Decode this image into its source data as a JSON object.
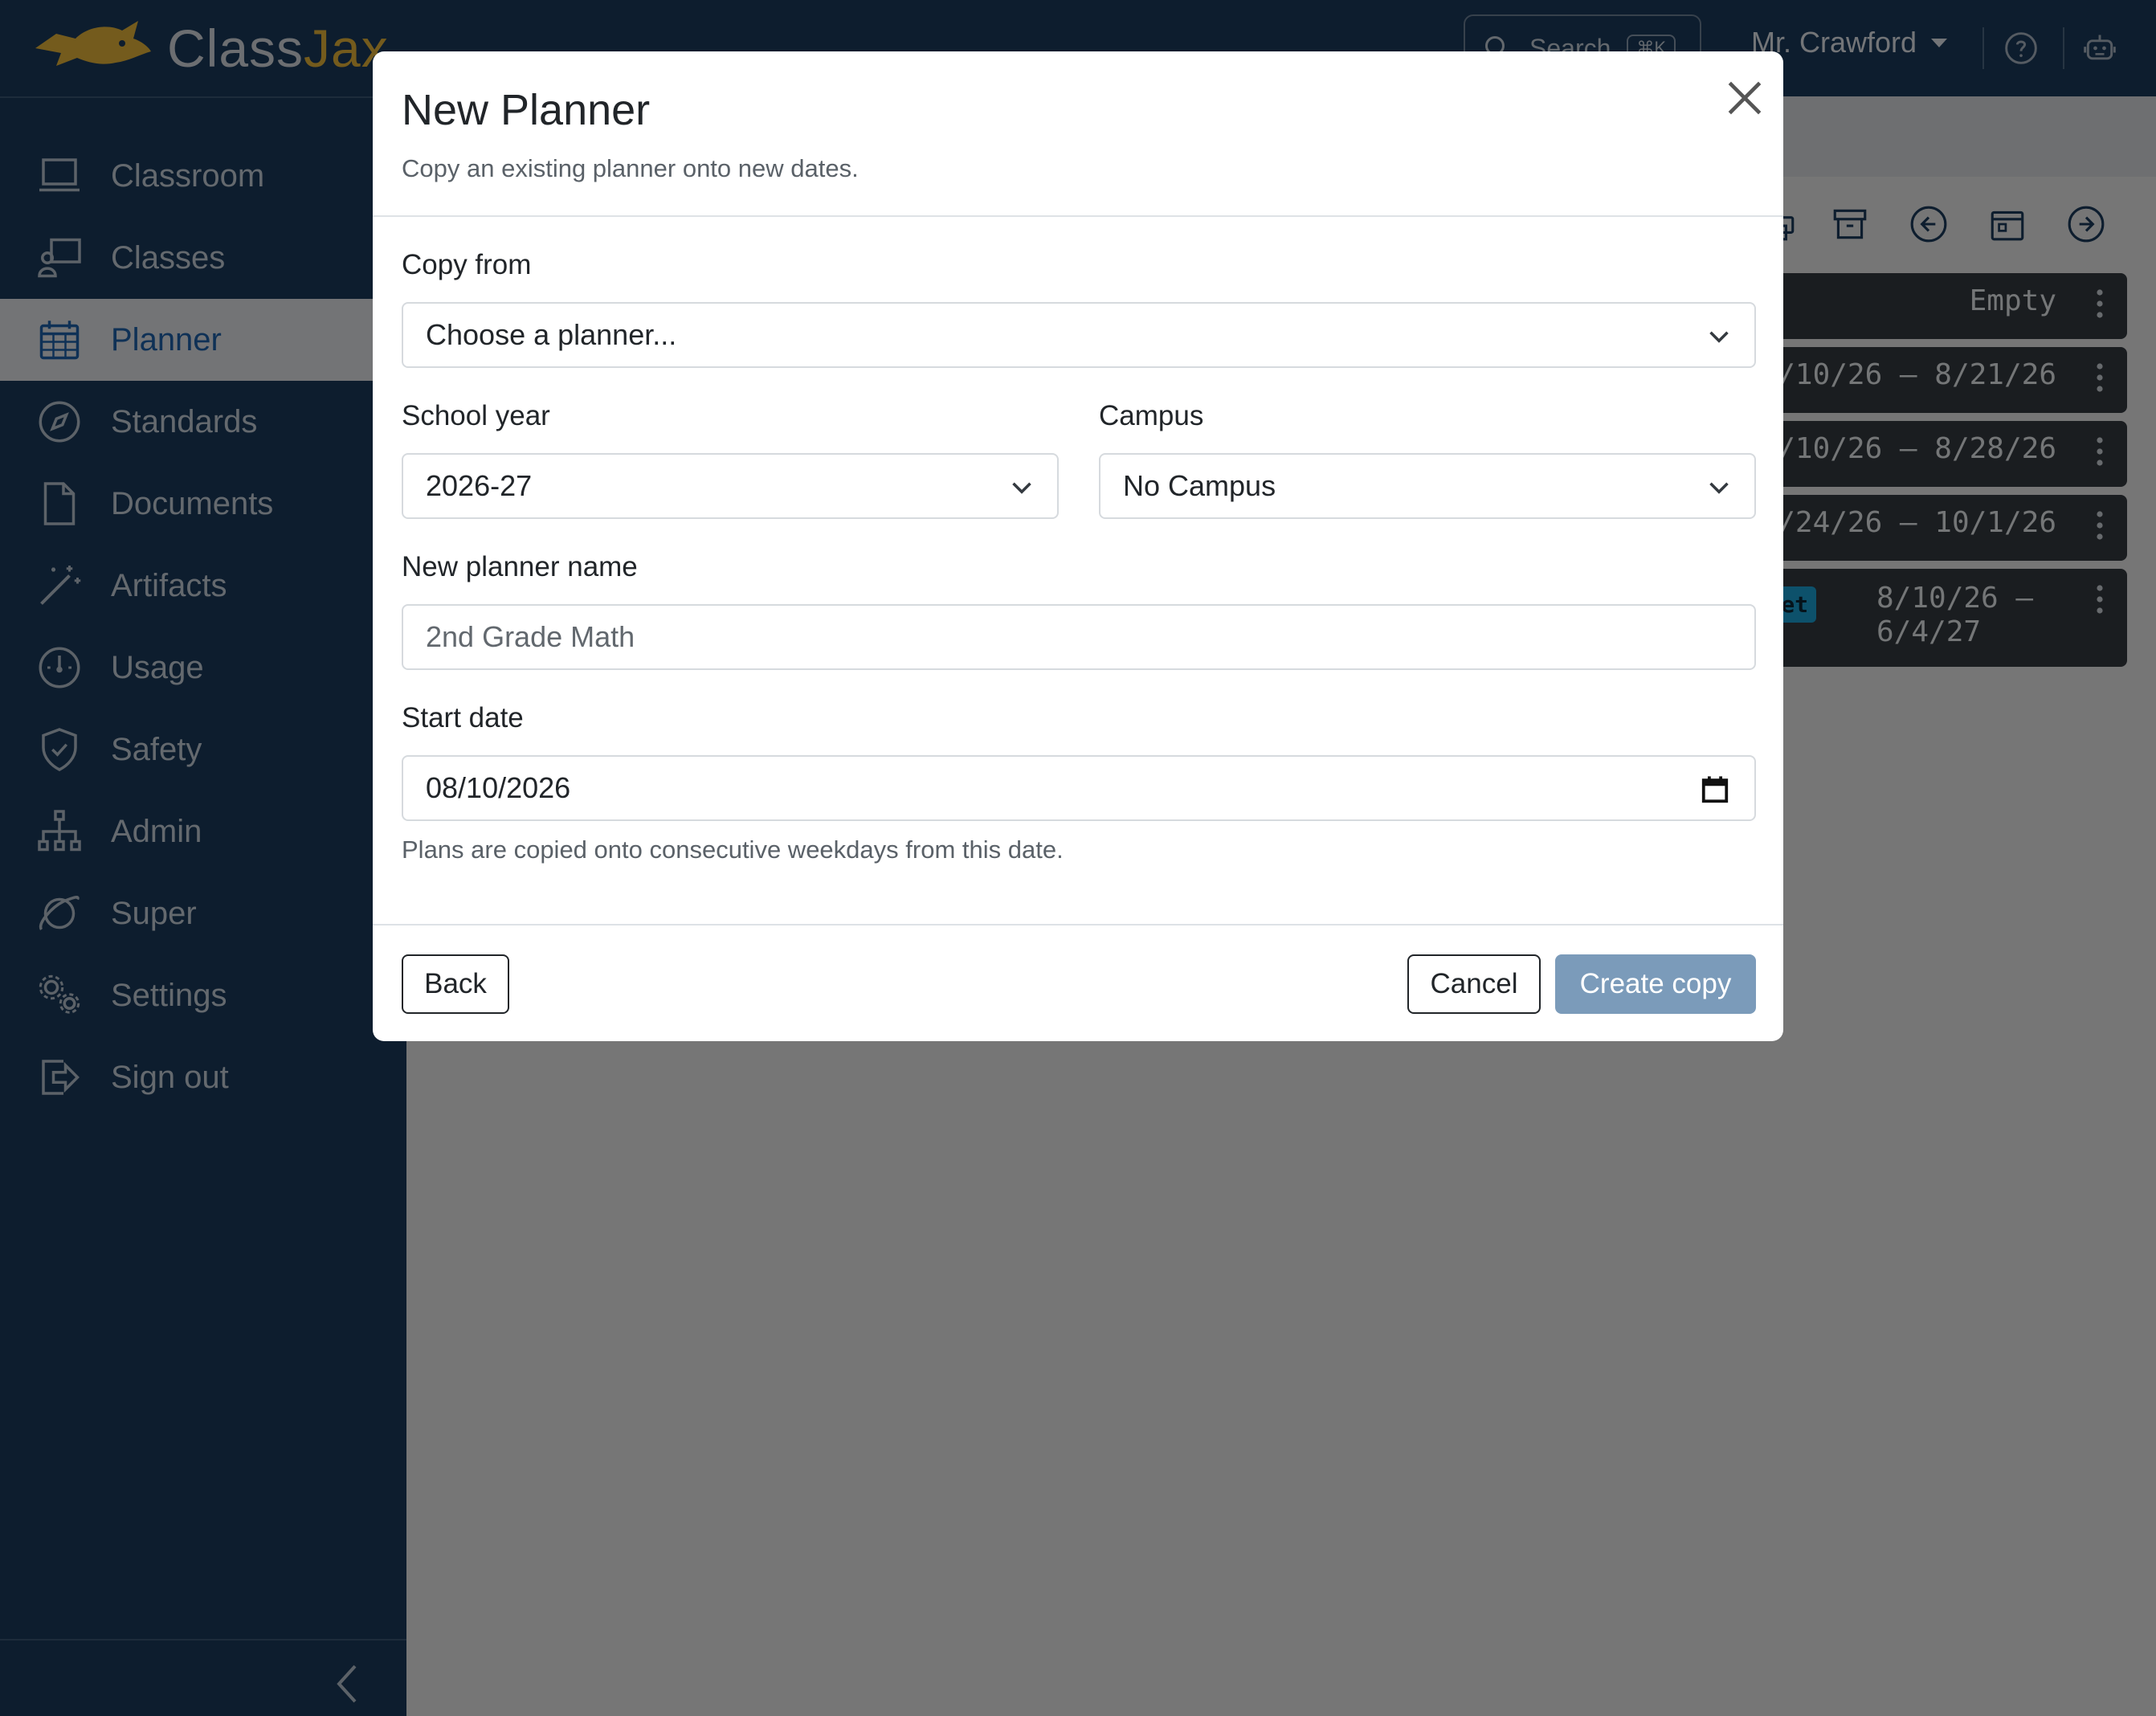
{
  "app": {
    "brand_class": "Class",
    "brand_jax": "Jax",
    "search_placeholder": "Search",
    "search_shortcut": "⌘K",
    "user_name": "Mr. Crawford"
  },
  "sidebar": {
    "items": [
      {
        "label": "Classroom",
        "icon": "laptop-icon"
      },
      {
        "label": "Classes",
        "icon": "teacher-board-icon"
      },
      {
        "label": "Planner",
        "icon": "calendar-grid-icon",
        "active": true
      },
      {
        "label": "Standards",
        "icon": "compass-icon"
      },
      {
        "label": "Documents",
        "icon": "document-icon"
      },
      {
        "label": "Artifacts",
        "icon": "magic-wand-icon"
      },
      {
        "label": "Usage",
        "icon": "gauge-icon"
      },
      {
        "label": "Safety",
        "icon": "shield-check-icon"
      },
      {
        "label": "Admin",
        "icon": "org-chart-icon"
      },
      {
        "label": "Super",
        "icon": "orbit-icon"
      },
      {
        "label": "Settings",
        "icon": "gears-icon"
      },
      {
        "label": "Sign out",
        "icon": "sign-out-icon"
      }
    ]
  },
  "background": {
    "planner_rows": [
      {
        "text": "Empty"
      },
      {
        "text": "/10/26 – 8/21/26"
      },
      {
        "text": "/10/26 – 8/28/26"
      },
      {
        "text": "/24/26 – 10/1/26"
      },
      {
        "badge": "Sacket",
        "text_line1": "8/10/26 –",
        "text_line2": "6/4/27"
      }
    ]
  },
  "modal": {
    "title": "New Planner",
    "subtitle": "Copy an existing planner onto new dates.",
    "copy_from_label": "Copy from",
    "copy_from_value": "Choose a planner...",
    "school_year_label": "School year",
    "school_year_value": "2026-27",
    "campus_label": "Campus",
    "campus_value": "No Campus",
    "planner_name_label": "New planner name",
    "planner_name_placeholder": "2nd Grade Math",
    "start_date_label": "Start date",
    "start_date_value": "08/10/2026",
    "help_text": "Plans are copied onto consecutive weekdays from this date.",
    "back_label": "Back",
    "cancel_label": "Cancel",
    "create_label": "Create copy"
  },
  "colors": {
    "navy": "#1a3a5c",
    "brand_gold": "#e8b73a",
    "primary_disabled": "#7b9bba",
    "active_link": "#1e63ad"
  }
}
